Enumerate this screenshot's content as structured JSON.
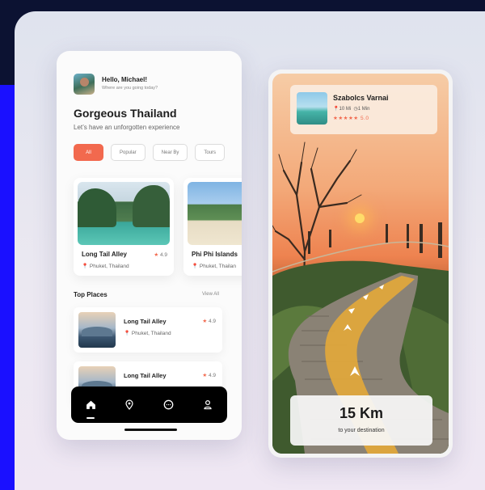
{
  "left_phone": {
    "greeting": "Hello, Michael!",
    "greeting_sub": "Where are you going today?",
    "title": "Gorgeous Thailand",
    "subtitle": "Let’s have an unforgotten experience",
    "chips": [
      "All",
      "Popular",
      "Near By",
      "Tours"
    ],
    "featured": [
      {
        "name": "Long Tail Alley",
        "location": "Phuket, Thailand",
        "rating": "4.9"
      },
      {
        "name": "Phi Phi Islands",
        "location": "Phuket, Thailan",
        "rating": ""
      }
    ],
    "top_places_title": "Top Places",
    "view_all": "View All",
    "top_places": [
      {
        "name": "Long Tail Alley",
        "location": "Phuket, Thailand",
        "rating": "4.9"
      },
      {
        "name": "Long Tail Alley",
        "location": "",
        "rating": "4.9"
      }
    ],
    "nav": [
      "home-icon",
      "map-pin-icon",
      "chat-icon",
      "profile-icon"
    ]
  },
  "right_phone": {
    "name": "Szabolcs Varnai",
    "distance": "10 Mi",
    "time": "1 Min",
    "rating": "5.0",
    "km": "15 Km",
    "destination_label": "to your destination"
  },
  "colors": {
    "accent": "#f2694e",
    "nav_bg": "#000000",
    "dark_bg": "#0c1232",
    "blue_bg": "#1a10ff"
  }
}
